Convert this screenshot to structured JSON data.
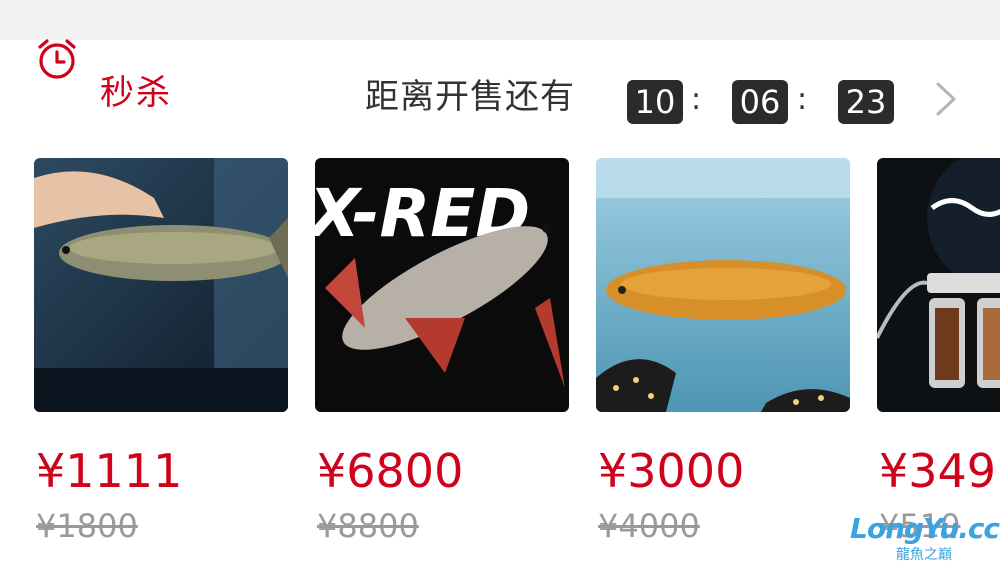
{
  "flash_sale": {
    "title": "秒杀",
    "icon": "alarm-clock-icon",
    "accent_color": "#d0021b",
    "countdown": {
      "label": "距离开售还有",
      "hours": "10",
      "minutes": "06",
      "seconds": "23",
      "separator": ":"
    },
    "more_icon": "chevron-right-icon"
  },
  "products": [
    {
      "price": "¥1111",
      "original_price": "¥1800"
    },
    {
      "price": "¥6800",
      "original_price": "¥8800",
      "image_text": "X-RED"
    },
    {
      "price": "¥3000",
      "original_price": "¥4000"
    },
    {
      "price": "¥349",
      "original_price": "¥510"
    }
  ],
  "watermark": {
    "brand": "LongYu.cc",
    "sub": "龍魚之巔"
  }
}
